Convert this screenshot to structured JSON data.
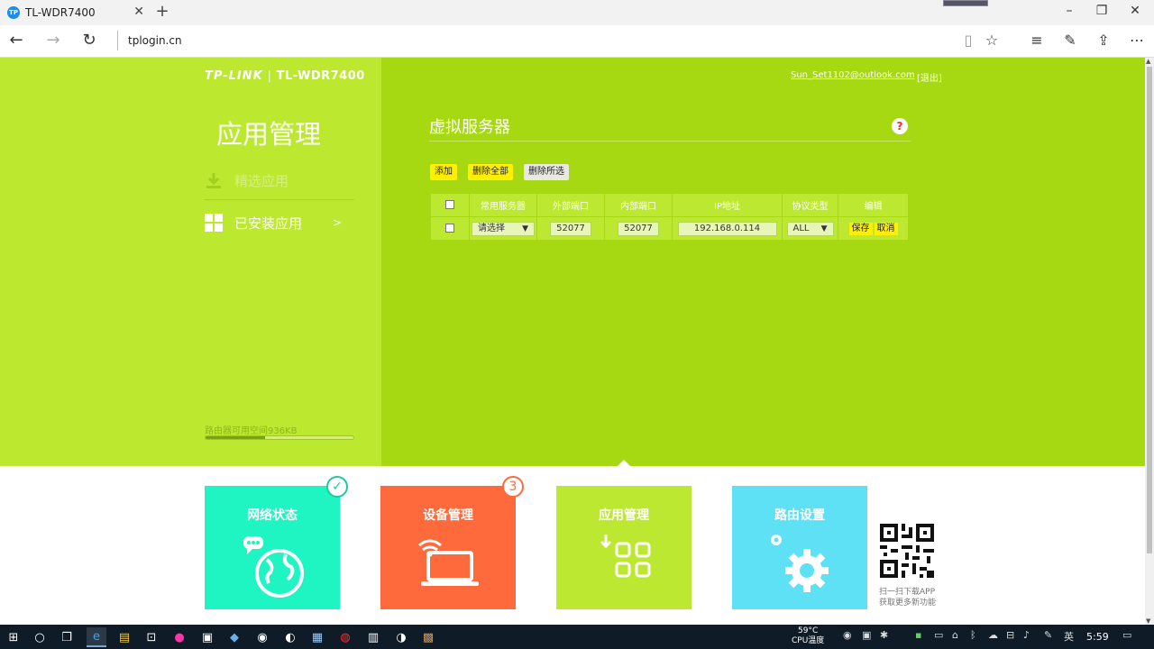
{
  "browser": {
    "tab_title": "TL-WDR7400",
    "tab_favicon": "TP",
    "url": "tplogin.cn",
    "new_tab": "+",
    "close_tab": "✕"
  },
  "router": {
    "logo_brand": "TP-LINK",
    "logo_model": "TL-WDR7400",
    "user_email": "Sun_Set1102@outlook.com",
    "logout": "[退出]",
    "sidebar": {
      "title": "应用管理",
      "items": [
        {
          "label": "精选应用",
          "icon": "download-icon"
        },
        {
          "label": "已安装应用",
          "icon": "apps-grid-icon",
          "arrow": ">"
        }
      ],
      "storage_label": "路由器可用空间936KB",
      "storage_fraction": 0.4
    },
    "main": {
      "title": "虚拟服务器",
      "help": "?",
      "buttons": {
        "add": "添加",
        "delete_all": "删除全部",
        "delete_selected": "删除所选"
      },
      "table": {
        "headers": [
          "常用服务器",
          "外部端口",
          "内部端口",
          "IP地址",
          "协议类型",
          "编辑"
        ],
        "row": {
          "service": "请选择",
          "external_port": "52077",
          "internal_port": "52077",
          "ip": "192.168.0.114",
          "protocol": "ALL",
          "save": "保存",
          "cancel": "取消"
        }
      }
    },
    "tiles": [
      {
        "label": "网络状态",
        "color": "#1ff5c3",
        "badge": "✓",
        "badge_color": "#1ec9a0"
      },
      {
        "label": "设备管理",
        "color": "#ff6a3d",
        "badge": "3",
        "badge_color": "#ff6a3d"
      },
      {
        "label": "应用管理",
        "color": "#bde832",
        "badge": "",
        "badge_color": ""
      },
      {
        "label": "路由设置",
        "color": "#5ee0f5",
        "badge": "",
        "badge_color": ""
      }
    ],
    "qr_text_line1": "扫一扫下载APP",
    "qr_text_line2": "获取更多新功能"
  },
  "taskbar": {
    "temp": "59°C",
    "temp_label": "CPU温度",
    "ime": "英",
    "time": "5:59"
  }
}
